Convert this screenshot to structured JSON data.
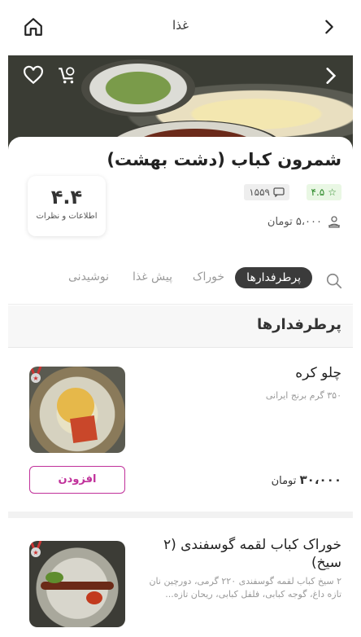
{
  "header": {
    "title": "غذا"
  },
  "restaurant": {
    "name": "شمرون کباب (دشت بهشت)",
    "rating": "۴.۵",
    "reviews_count": "۱۵۵۹",
    "delivery_fee": "۵،۰۰۰ تومان",
    "info_number": "۴.۴",
    "info_label": "اطلاعات و نظرات"
  },
  "tabs": [
    {
      "label": "پرطرفدارها",
      "active": true
    },
    {
      "label": "خوراک",
      "active": false
    },
    {
      "label": "پیش غذا",
      "active": false
    },
    {
      "label": "نوشیدنی",
      "active": false
    }
  ],
  "section_title": "پرطرفدارها",
  "items": [
    {
      "name": "چلو کره",
      "desc": "۳۵۰ گرم برنج ایرانی",
      "price": "۳۰،۰۰۰",
      "currency": "تومان",
      "add_label": "افزودن"
    },
    {
      "name": "خوراک کباب لقمه گوسفندی (۲ سیخ)",
      "desc": "۲ سیخ کباب لقمه گوسفندی ۲۲۰ گرمی، دورچین نان تازه داغ، گوجه کبابی، فلفل کبابی، ریحان تازه...",
      "price": "",
      "currency": "",
      "add_label": ""
    }
  ],
  "colors": {
    "accent": "#c0309a",
    "rating_green": "#2e8b2a",
    "tab_active": "#3b3b3b"
  }
}
